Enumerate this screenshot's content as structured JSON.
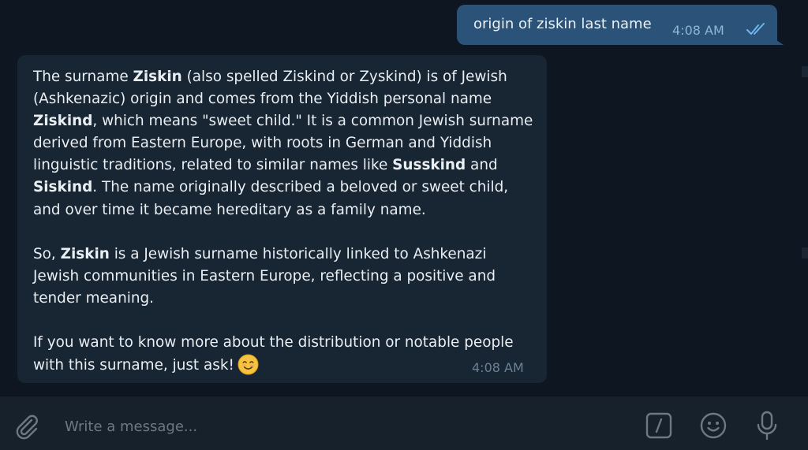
{
  "outgoing": {
    "text": "origin of ziskin last name",
    "time": "4:08 AM",
    "status_icon": "double-check-icon"
  },
  "incoming": {
    "p1": {
      "a": "The surname ",
      "b": "Ziskin",
      "c": " (also spelled Ziskind or Zyskind) is of Jewish (Ashkenazic) origin and comes from the Yiddish personal name ",
      "d": "Ziskind",
      "e": ", which means \"sweet child.\" It is a common Jewish surname derived from Eastern Europe, with roots in German and Yiddish linguistic traditions, related to similar names like ",
      "f": "Susskind",
      "g": " and ",
      "h": "Siskind",
      "i": ". The name originally described a beloved or sweet child, and over time it became hereditary as a family name."
    },
    "p2": {
      "a": "So, ",
      "b": "Ziskin",
      "c": " is a Jewish surname historically linked to Ashkenazi Jewish communities in Eastern Europe, reflecting a positive and tender meaning."
    },
    "p3": {
      "a": "If you want to know more about the distribution or notable people with this surname, just ask!",
      "emoji": "smiling-face-emoji"
    },
    "time": "4:08 AM"
  },
  "composer": {
    "placeholder": "Write a message...",
    "value": "",
    "icons": [
      "paperclip-icon",
      "bot-command-icon",
      "emoji-icon",
      "microphone-icon"
    ]
  },
  "colors": {
    "background": "#0e1621",
    "outgoing_bubble": "#2b5278",
    "incoming_bubble": "#182533",
    "composer": "#17212b",
    "icon": "#6d7883"
  }
}
